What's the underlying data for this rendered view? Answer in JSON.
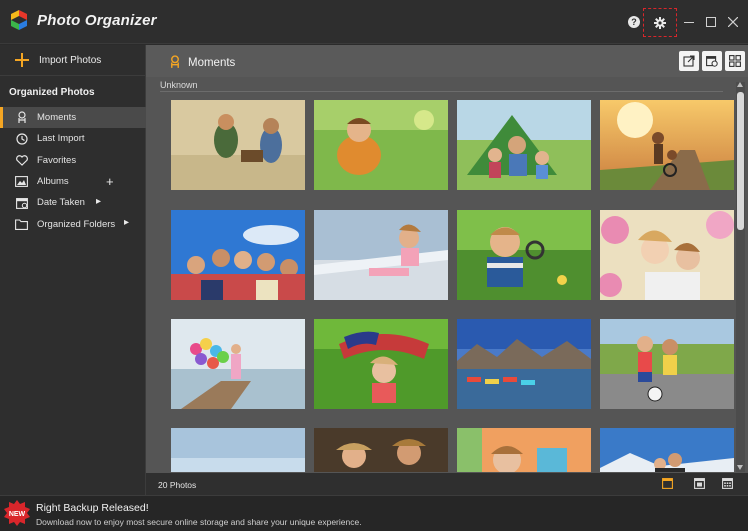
{
  "app": {
    "title": "Photo Organizer"
  },
  "window_controls": {
    "help": "?",
    "minimize": "—",
    "maximize": "☐",
    "close": "✕"
  },
  "sidebar": {
    "import_label": "Import Photos",
    "section_title": "Organized Photos",
    "items": [
      {
        "label": "Moments",
        "icon": "moments-icon",
        "active": true
      },
      {
        "label": "Last Import",
        "icon": "last-import-icon"
      },
      {
        "label": "Favorites",
        "icon": "heart-icon"
      },
      {
        "label": "Albums",
        "icon": "albums-icon",
        "trail": "+"
      },
      {
        "label": "Date Taken",
        "icon": "calendar-icon",
        "trail": "▸"
      },
      {
        "label": "Organized Folders",
        "icon": "folder-icon",
        "trail": "▸"
      }
    ]
  },
  "main": {
    "title": "Moments",
    "group_label": "Unknown",
    "photo_count": "20 Photos"
  },
  "colors": {
    "accent": "#f5a623",
    "highlight_border": "#d9262b",
    "panel": "#555555",
    "sidebar": "#2e2e2e"
  },
  "notification": {
    "badge": "NEW",
    "title": "Right Backup Released!",
    "text": "Download now to enjoy most secure online storage and share your unique experience."
  }
}
